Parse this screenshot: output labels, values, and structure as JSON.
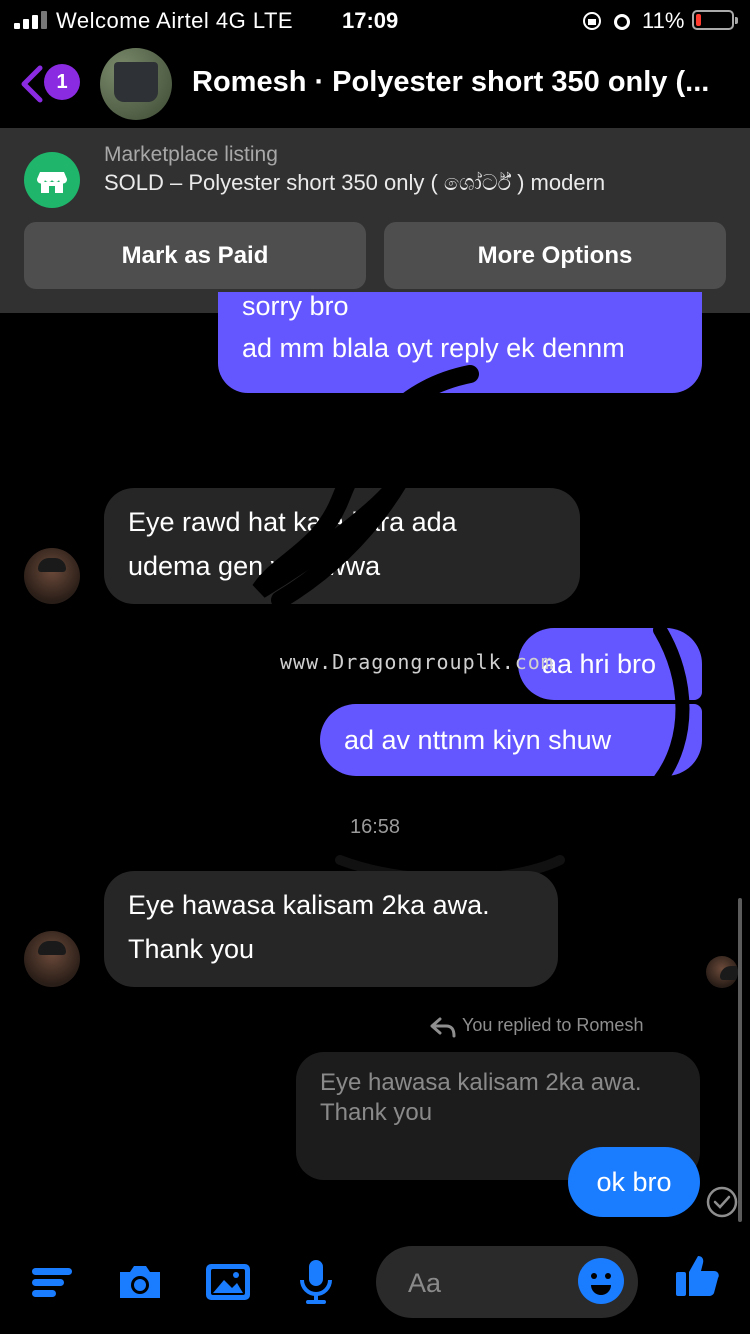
{
  "status_bar": {
    "carrier": "Welcome Airtel 4G  LTE",
    "time": "17:09",
    "battery_percent": "11%"
  },
  "header": {
    "back_badge": "1",
    "title": "Romesh · Polyester short 350 only (..."
  },
  "marketplace": {
    "label": "Marketplace listing",
    "title": "SOLD – Polyester short 350 only ( ශෝර්ට් ) modern",
    "buttons": [
      "Mark as Paid",
      "More Options"
    ]
  },
  "messages": [
    {
      "from": "me",
      "lines": [
        "sorry bro",
        "ad mm blala oyt reply ek dennm"
      ]
    },
    {
      "from": "them",
      "lines": [
        "Eye rawd     hat   kata kara  ada",
        "udema gen   va kiwwa"
      ]
    },
    {
      "from": "me",
      "lines": [
        "aa hri bro"
      ]
    },
    {
      "from": "me",
      "lines": [
        "ad av nttnm kiyn shuw"
      ]
    },
    {
      "from": "them",
      "lines": [
        "Eye hawasa kalisam 2ka awa.",
        "Thank you"
      ]
    }
  ],
  "timestamp": "16:58",
  "watermark": "www.Dragongrouplk.com",
  "reply": {
    "indicator": "You replied to Romesh",
    "quoted": "Eye hawasa kalisam 2ka awa.\nThank you",
    "message": "ok bro"
  },
  "composer": {
    "placeholder": "Aa"
  },
  "colors": {
    "outgoing_bubble": "#6557ff",
    "incoming_bubble": "#262626",
    "accent_blue": "#1a7cff",
    "marketplace_green": "#1fb56a",
    "badge_purple": "#8a2be2"
  },
  "icons": [
    "menu-icon",
    "camera-icon",
    "gallery-icon",
    "mic-icon",
    "emoji-icon",
    "like-icon",
    "storefront-icon",
    "back-chevron-icon"
  ]
}
